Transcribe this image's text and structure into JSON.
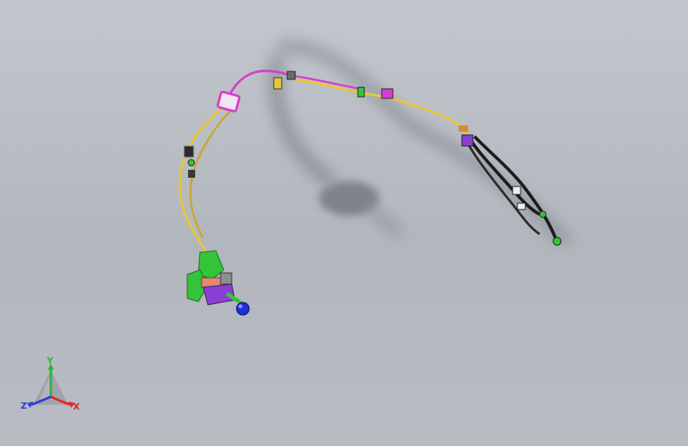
{
  "viewport": {
    "background_top": "#c3c7cd",
    "background_bottom": "#b2b6bd",
    "model": "cable-harness-assembly"
  },
  "colors": {
    "cable_yellow": "#e7c63a",
    "cable_magenta": "#d43fd0",
    "cable_black": "#1d1d1d",
    "part_green": "#34c43a",
    "part_purple": "#8a3fd2",
    "part_salmon": "#e08a72",
    "knob_blue": "#1d2fd8",
    "shadow": "#6e7179",
    "axis_x": "#e0262a",
    "axis_y": "#2fb33a",
    "axis_z": "#2c3fd0"
  },
  "triad": {
    "x_label": "X",
    "y_label": "Y",
    "z_label": "Z"
  }
}
